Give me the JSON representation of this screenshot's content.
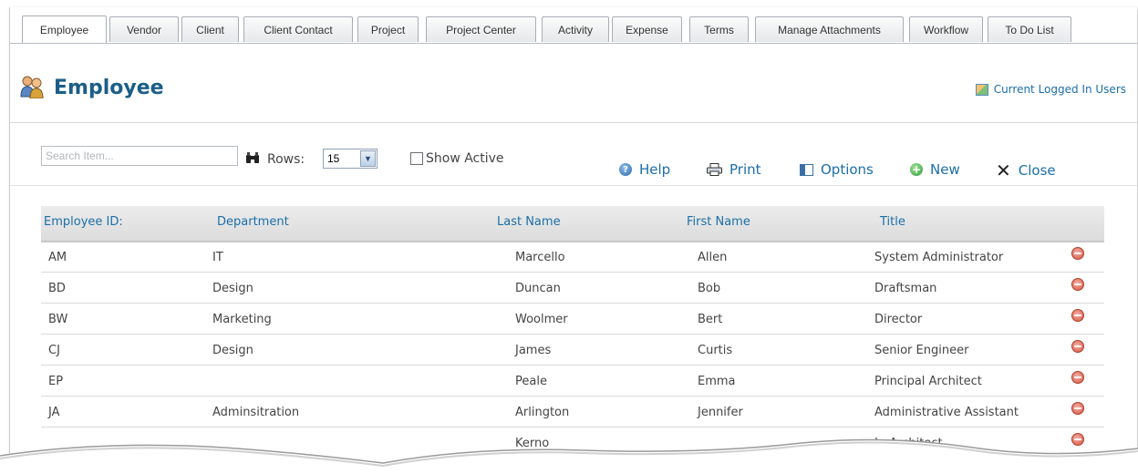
{
  "tabs": [
    {
      "label": "Employee",
      "active": true
    },
    {
      "label": "Vendor"
    },
    {
      "label": "Client"
    },
    {
      "label": "Client Contact"
    },
    {
      "label": "Project"
    },
    {
      "label": "Project Center"
    },
    {
      "label": "Activity"
    },
    {
      "label": "Expense"
    },
    {
      "label": "Terms"
    },
    {
      "label": "Manage Attachments"
    },
    {
      "label": "Workflow"
    },
    {
      "label": "To Do List"
    }
  ],
  "header": {
    "title": "Employee",
    "logged_in_link": "Current Logged In Users"
  },
  "toolbar": {
    "search_placeholder": "Search Item...",
    "rows_label": "Rows:",
    "rows_value": "15",
    "show_active_label": "Show Active",
    "help": "Help",
    "print": "Print",
    "options": "Options",
    "new": "New",
    "close": "Close"
  },
  "table": {
    "columns": [
      "Employee ID:",
      "Department",
      "Last Name",
      "First Name",
      "Title"
    ],
    "rows": [
      {
        "id": "AM",
        "dept": "IT",
        "last": "Marcello",
        "first": "Allen",
        "title": "System Administrator"
      },
      {
        "id": "BD",
        "dept": "Design",
        "last": "Duncan",
        "first": "Bob",
        "title": "Draftsman"
      },
      {
        "id": "BW",
        "dept": "Marketing",
        "last": "Woolmer",
        "first": "Bert",
        "title": "Director"
      },
      {
        "id": "CJ",
        "dept": "Design",
        "last": "James",
        "first": "Curtis",
        "title": "Senior Engineer"
      },
      {
        "id": "EP",
        "dept": "",
        "last": "Peale",
        "first": "Emma",
        "title": "Principal Architect"
      },
      {
        "id": "JA",
        "dept": "Adminsitration",
        "last": "Arlington",
        "first": "Jennifer",
        "title": "Administrative Assistant"
      },
      {
        "id": "",
        "dept": "",
        "last": "Kerno",
        "first": "",
        "title": "Jr. Architect"
      }
    ]
  },
  "colors": {
    "link": "#1b6fa8",
    "title": "#1a5e87",
    "delete": "#d4523f"
  }
}
